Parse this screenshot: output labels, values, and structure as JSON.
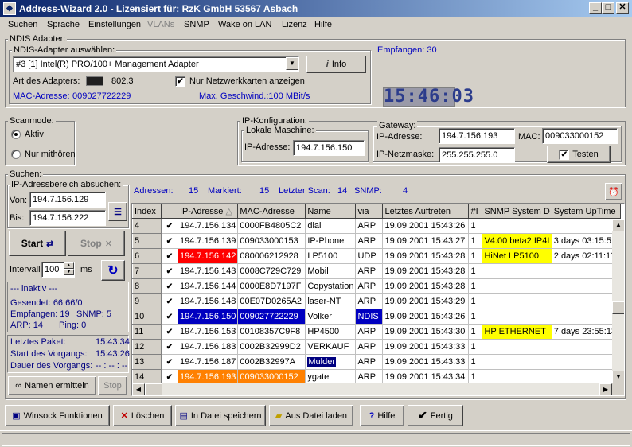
{
  "window": {
    "title": "Address-Wizard 2.0   -   Lizensiert für: RzK GmbH   53567 Asbach",
    "min": "_",
    "max": "□",
    "close": "✕"
  },
  "menu": [
    "Suchen",
    "Sprache",
    "Einstellungen",
    "VLANs",
    "SNMP",
    "Wake on LAN",
    "Lizenz",
    "Hilfe"
  ],
  "ndis": {
    "group": "NDIS Adapter:",
    "select_group": "NDIS-Adapter auswählen:",
    "adapter": "#3 [1] Intel(R) PRO/100+ Management Adapter",
    "info_button": "Info",
    "type_label": "Art des Adapters:",
    "type_value": "802.3",
    "only_network_cards": "Nur Netzwerkkarten anzeigen",
    "mac_label": "MAC-Adresse:",
    "mac_value": "009027722229",
    "speed": "Max. Geschwind.:100 MBit/s",
    "received": "Empfangen: 30",
    "clock": "15:46:03"
  },
  "scanmode": {
    "group": "Scanmode:",
    "active": "Aktiv",
    "listen": "Nur mithören"
  },
  "ipconf": {
    "group": "IP-Konfiguration:",
    "local_group": "Lokale Maschine:",
    "ip_label": "IP-Adresse:",
    "ip_value": "194.7.156.150"
  },
  "gateway": {
    "group": "Gateway:",
    "ip_label": "IP-Adresse:",
    "ip_value": "194.7.156.193",
    "mac_label": "MAC:",
    "mac_value": "009033000152",
    "mask_label": "IP-Netzmaske:",
    "mask_value": "255.255.255.0",
    "test_button": "Testen"
  },
  "search": {
    "group": "Suchen:",
    "range_group": "IP-Adressbereich absuchen:",
    "from_label": "Von:",
    "from_value": "194.7.156.129",
    "to_label": "Bis:",
    "to_value": "194.7.156.222",
    "start": "Start",
    "stop": "Stop",
    "interval_label": "Intervall:",
    "interval_value": "100",
    "interval_unit": "ms"
  },
  "stats": {
    "state": "--- inaktiv ---",
    "sent": "Gesendet: 66 66/0",
    "received": "Empfangen: 19",
    "snmp": "SNMP: 5",
    "arp": "ARP: 14",
    "ping": "Ping: 0",
    "last_label": "Letztes Paket:",
    "last_value": "15:43:34",
    "start_label": "Start des Vorgangs:",
    "start_value": "15:43:26",
    "dur_label": "Dauer des Vorgangs:",
    "dur_value": "-- : -- : --",
    "names_button": "Namen ermitteln",
    "stop_button": "Stop"
  },
  "summary": {
    "addr_label": "Adressen:",
    "addr": "15",
    "marked_label": "Markiert:",
    "marked": "15",
    "last_label": "Letzter Scan:",
    "last": "14",
    "snmp_label": "SNMP:",
    "snmp": "4"
  },
  "table": {
    "headers": [
      "Index",
      "",
      "IP-Adresse",
      "MAC-Adresse",
      "Name",
      "via",
      "Letztes Auftreten",
      "#I",
      "SNMP System D",
      "System UpTime"
    ],
    "rows": [
      [
        "4",
        "✔",
        "194.7.156.134",
        "0000FB4805C2",
        "dial",
        "ARP",
        "19.09.2001 15:43:26",
        "1",
        "",
        ""
      ],
      [
        "5",
        "✔",
        "194.7.156.139",
        "009033000153",
        "IP-Phone",
        "ARP",
        "19.09.2001 15:43:27",
        "1",
        "V4.00 beta2 IP4I",
        "3 days 03:15:51."
      ],
      [
        "6",
        "✔",
        "194.7.156.142",
        "080006212928",
        "LP5100",
        "UDP",
        "19.09.2001 15:43:28",
        "1",
        "HiNet LP5100",
        "2 days 02:11:11."
      ],
      [
        "7",
        "✔",
        "194.7.156.143",
        "0008C729C729",
        "Mobil",
        "ARP",
        "19.09.2001 15:43:28",
        "1",
        "",
        ""
      ],
      [
        "8",
        "✔",
        "194.7.156.144",
        "0000E8D7197F",
        "Copystation",
        "ARP",
        "19.09.2001 15:43:28",
        "1",
        "",
        ""
      ],
      [
        "9",
        "✔",
        "194.7.156.148",
        "00E07D0265A2",
        "laser-NT",
        "ARP",
        "19.09.2001 15:43:29",
        "1",
        "",
        ""
      ],
      [
        "10",
        "✔",
        "194.7.156.150",
        "009027722229",
        "Volker",
        "NDIS",
        "19.09.2001 15:43:26",
        "1",
        "",
        ""
      ],
      [
        "11",
        "✔",
        "194.7.156.153",
        "00108357C9F8",
        "HP4500",
        "ARP",
        "19.09.2001 15:43:30",
        "1",
        "HP ETHERNET",
        "7 days 23:55:13."
      ],
      [
        "12",
        "✔",
        "194.7.156.183",
        "0002B32999D2",
        "VERKAUF",
        "ARP",
        "19.09.2001 15:43:33",
        "1",
        "",
        ""
      ],
      [
        "13",
        "✔",
        "194.7.156.187",
        "0002B32997A",
        "Mulder",
        "ARP",
        "19.09.2001 15:43:33",
        "1",
        "",
        ""
      ],
      [
        "14",
        "✔",
        "194.7.156.193",
        "009033000152",
        "ygate",
        "ARP",
        "19.09.2001 15:43:34",
        "1",
        "",
        ""
      ]
    ]
  },
  "colors": {
    "red": "#ff0000",
    "blue": "#0000c0",
    "orange": "#ff8000",
    "yellow": "#ffff00",
    "navy": "#000080"
  },
  "bottom": {
    "winsock": "Winsock Funktionen",
    "delete": "Löschen",
    "save": "In Datei speichern",
    "load": "Aus Datei laden",
    "help": "Hilfe",
    "done": "Fertig"
  }
}
